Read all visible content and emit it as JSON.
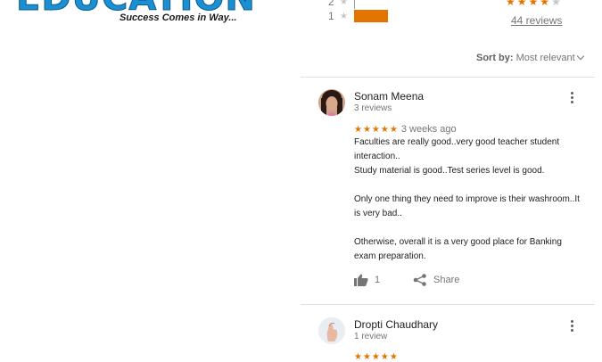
{
  "logo": {
    "text": "EDUCATION",
    "tagline": "Success Comes in Way..."
  },
  "histogram": {
    "rows": [
      {
        "stars": "2",
        "fraction": 0.0
      },
      {
        "stars": "1",
        "fraction": 0.19
      }
    ],
    "bar_color": "#e37400"
  },
  "summary": {
    "rating": 4,
    "max": 5,
    "reviews_label": "44 reviews"
  },
  "sort": {
    "label": "Sort by:",
    "value": "Most relevant"
  },
  "reviews": [
    {
      "name": "Sonam Meena",
      "review_count": "3 reviews",
      "stars": "★★★★★",
      "date": "3 weeks ago",
      "lines": [
        "Faculties are really good..very good teacher student interaction..",
        "Study material is good..Test series level is good.",
        "",
        "Only one thing they need to improve is their washroom..It is very bad..",
        "",
        "Otherwise,  overall it is a very good place for Banking exam preparation."
      ],
      "likes": "1",
      "share_label": "Share"
    },
    {
      "name": "Dropti Chaudhary",
      "review_count": "1 review",
      "stars": "★★★★★"
    }
  ],
  "icons": {
    "thumb": "thumbs-up-icon",
    "share": "share-icon",
    "more": "more-vert-icon"
  }
}
